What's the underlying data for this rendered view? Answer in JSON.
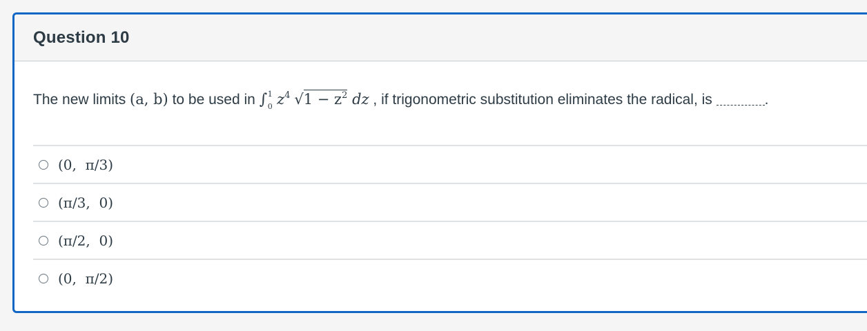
{
  "question": {
    "title": "Question 10",
    "text_before": "The new limits ",
    "limits_vars": "(a,  b)",
    "text_mid": " to be used in ",
    "integral_symbol": "∫",
    "integral_upper": "1",
    "integral_lower": "0",
    "integrand_base": "z",
    "integrand_exp": "4",
    "sqrt_symbol": "√",
    "radicand": "1 − z",
    "radicand_exp": "2",
    "differential": " dz",
    "text_after": " , if trigonometric substitution eliminates the radical,  is ",
    "text_end": "."
  },
  "answers": [
    {
      "label": "(0,  π/3)",
      "selected": false
    },
    {
      "label": "(π/3,  0)",
      "selected": false
    },
    {
      "label": "(π/2,  0)",
      "selected": false
    },
    {
      "label": "(0,  π/2)",
      "selected": false
    }
  ],
  "colors": {
    "card_border": "#1266c4",
    "header_bg": "#f5f5f5",
    "text": "#2d3b45",
    "divider": "#dfe2e5"
  }
}
